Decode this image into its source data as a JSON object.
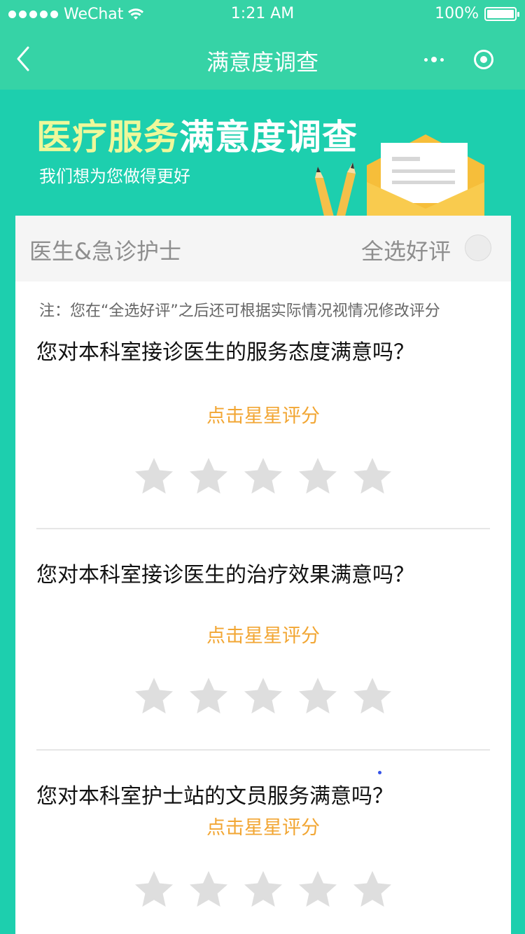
{
  "status_bar": {
    "carrier": "WeChat",
    "time": "1:21 AM",
    "battery": "100%"
  },
  "nav": {
    "title": "满意度调查"
  },
  "banner": {
    "title_highlight": "医疗服务",
    "title_rest": "满意度调查",
    "subtitle": "我们想为您做得更好"
  },
  "section": {
    "title": "医生&急诊护士",
    "select_all_label": "全选好评",
    "note": "注：您在“全选好评”之后还可根据实际情况视情况修改评分"
  },
  "questions": [
    {
      "text": "您对本科室接诊医生的服务态度满意吗？",
      "hint": "点击星星评分",
      "rating": 0,
      "max": 5
    },
    {
      "text": "您对本科室接诊医生的治疗效果满意吗？",
      "hint": "点击星星评分",
      "rating": 0,
      "max": 5
    },
    {
      "text": "您对本科室护士站的文员服务满意吗？",
      "hint": "点击星星评分",
      "rating": 0,
      "max": 5
    }
  ],
  "colors": {
    "header": "#36D3A6",
    "background": "#1DCFAE",
    "title_highlight": "#EEF89A",
    "hint": "#F2A633",
    "star_empty": "#DEDEDE"
  }
}
